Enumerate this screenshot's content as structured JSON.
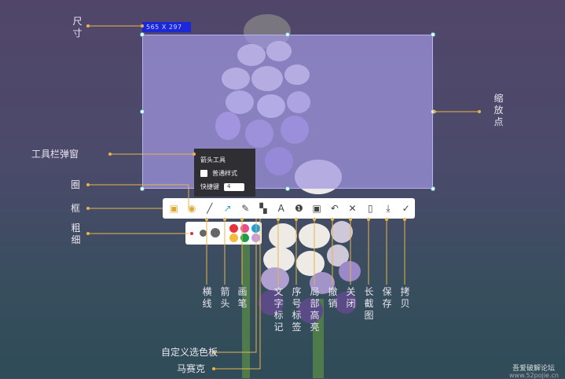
{
  "selection": {
    "size_label": "565  X 297"
  },
  "popup": {
    "title": "箭头工具",
    "checkbox_label": "普通样式",
    "shortcut_label": "快捷键",
    "shortcut_value": "4"
  },
  "annotations": {
    "size": "尺寸",
    "popup": "工具栏弹窗",
    "circle": "圈",
    "frame": "框",
    "thickness": "粗细",
    "zoom_points": "缩放点",
    "line": "横线",
    "arrow": "箭头",
    "pen": "画笔",
    "text": "文字标记",
    "number": "序号标签",
    "highlight": "局部高亮",
    "undo": "撤销",
    "close": "关闭",
    "long": "长截图",
    "save": "保存",
    "copy": "拷贝",
    "palette": "自定义选色板",
    "mosaic": "马赛克"
  },
  "toolbar": [
    {
      "icon": "rectangle-icon",
      "glyph": "▣"
    },
    {
      "icon": "circle-icon",
      "glyph": "◉"
    },
    {
      "icon": "line-icon",
      "glyph": "╱"
    },
    {
      "icon": "arrow-icon",
      "glyph": "↗"
    },
    {
      "icon": "pen-icon",
      "glyph": "✎"
    },
    {
      "icon": "mosaic-icon",
      "glyph": "▚"
    },
    {
      "icon": "text-icon",
      "glyph": "A"
    },
    {
      "icon": "number-icon",
      "glyph": "❶"
    },
    {
      "icon": "highlight-icon",
      "glyph": "▣"
    },
    {
      "icon": "undo-icon",
      "glyph": "↶"
    },
    {
      "icon": "close-icon",
      "glyph": "✕"
    },
    {
      "icon": "long-screenshot-icon",
      "glyph": "▯"
    },
    {
      "icon": "save-icon",
      "glyph": "⤓"
    },
    {
      "icon": "copy-icon",
      "glyph": "✓"
    }
  ],
  "colors": [
    "#e8323c",
    "#e6508c",
    "#1ea0dc",
    "#f5b93c",
    "#19a046",
    "#c89be6"
  ],
  "accent": "#e7b54a",
  "watermark": {
    "line1": "吾爱破解论坛",
    "line2": "www.52pojie.cn"
  }
}
